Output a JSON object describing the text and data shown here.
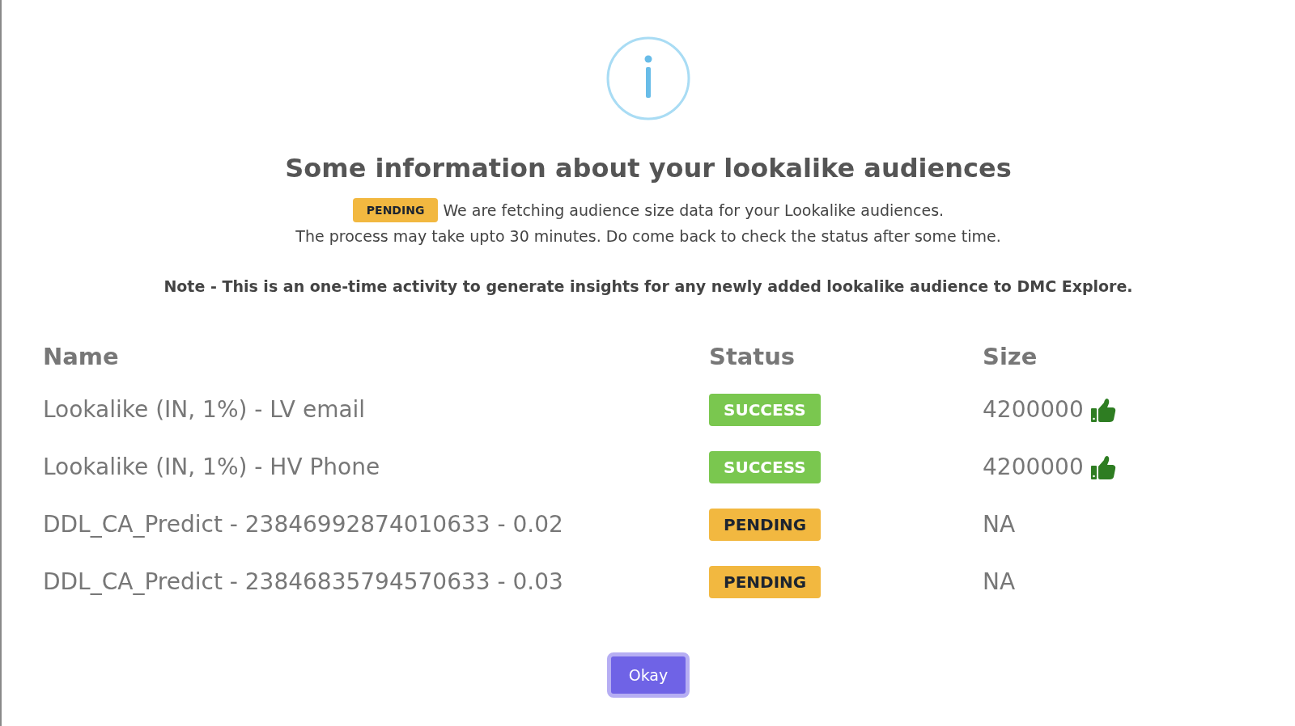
{
  "dialog": {
    "title": "Some information about your lookalike audiences",
    "intro": {
      "badge": {
        "label": "PENDING",
        "kind": "pending"
      },
      "text": "We are fetching audience size data for your Lookalike audiences."
    },
    "intro_line_2": "The process may take upto 30 minutes. Do come back to check the status after some time.",
    "note": "Note - This is an one-time activity to generate insights for any newly added lookalike audience to DMC Explore.",
    "table": {
      "columns": [
        "Name",
        "Status",
        "Size"
      ],
      "rows": [
        {
          "name": "Lookalike (IN, 1%) - LV email",
          "status": {
            "label": "SUCCESS",
            "kind": "success"
          },
          "size": "4200000",
          "thumbs_up": true
        },
        {
          "name": "Lookalike (IN, 1%) - HV Phone",
          "status": {
            "label": "SUCCESS",
            "kind": "success"
          },
          "size": "4200000",
          "thumbs_up": true
        },
        {
          "name": "DDL_CA_Predict - 23846992874010633 - 0.02",
          "status": {
            "label": "PENDING",
            "kind": "pending"
          },
          "size": "NA",
          "thumbs_up": false
        },
        {
          "name": "DDL_CA_Predict - 23846835794570633 - 0.03",
          "status": {
            "label": "PENDING",
            "kind": "pending"
          },
          "size": "NA",
          "thumbs_up": false
        }
      ]
    },
    "buttons": [
      "Okay"
    ]
  }
}
